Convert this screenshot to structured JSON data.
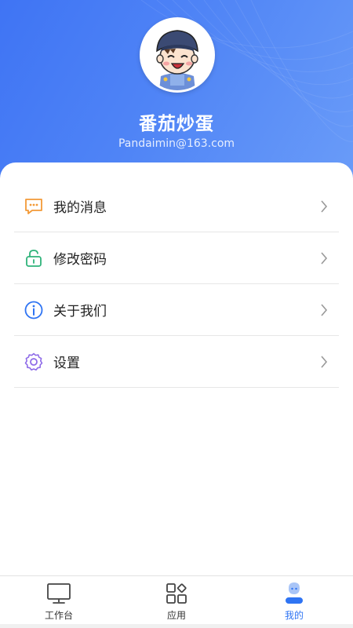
{
  "profile": {
    "name": "番茄炒蛋",
    "email": "Pandaimin@163.com"
  },
  "menu": [
    {
      "label": "我的消息",
      "icon": "message-icon",
      "color": "#f39a37"
    },
    {
      "label": "修改密码",
      "icon": "lock-icon",
      "color": "#2fb37a"
    },
    {
      "label": "关于我们",
      "icon": "info-icon",
      "color": "#2f74f3"
    },
    {
      "label": "设置",
      "icon": "gear-icon",
      "color": "#8f6ce8"
    }
  ],
  "tabs": [
    {
      "label": "工作台",
      "icon": "monitor-icon",
      "active": false
    },
    {
      "label": "应用",
      "icon": "apps-grid-icon",
      "active": false
    },
    {
      "label": "我的",
      "icon": "profile-icon",
      "active": true
    }
  ],
  "colors": {
    "accent": "#2f74f3",
    "header_start": "#3f74f4",
    "header_end": "#6a9cf8"
  }
}
